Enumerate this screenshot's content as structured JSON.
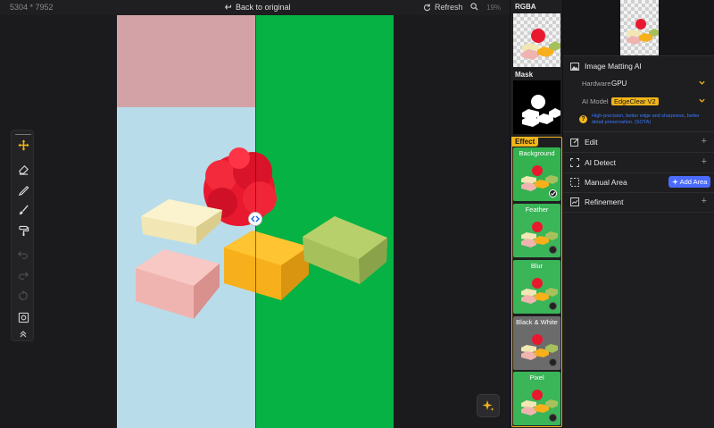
{
  "topbar": {
    "dimensions": "5304 * 7952",
    "back_label": "Back to original",
    "refresh_label": "Refresh",
    "zoom": "19%"
  },
  "thumbs": {
    "rgba_title": "RGBA",
    "mask_title": "Mask",
    "effect_tag": "Effect",
    "effects": [
      {
        "label": "Background",
        "selected": true,
        "bg": "#33b24f"
      },
      {
        "label": "Feather",
        "selected": false,
        "bg": "#3ab558"
      },
      {
        "label": "Blur",
        "selected": false,
        "bg": "#3ab558"
      },
      {
        "label": "Black & White",
        "selected": false,
        "bg": "#6b6b6b"
      },
      {
        "label": "Pixel",
        "selected": false,
        "bg": "#3ab558"
      }
    ]
  },
  "panel": {
    "matting_title": "Image Matting AI",
    "hardware_label": "Hardware",
    "hardware_value": "GPU",
    "model_label": "AI Model",
    "model_value": "EdgeClear  V2",
    "model_note": "High-precision, better edge and sharpness, better detail preservation. (SOTA)",
    "edit_title": "Edit",
    "ai_detect_title": "AI Detect",
    "manual_area_title": "Manual Area",
    "add_area_label": "Add Area",
    "refinement_title": "Refinement"
  },
  "colors": {
    "accent": "#f2b51a",
    "green_screen": "#05b243",
    "add_area_bg": "#4b6bff",
    "link_blue": "#3b79ff"
  },
  "icons": [
    "back-icon",
    "refresh-icon",
    "search-icon",
    "move-icon",
    "eraser-icon",
    "brush-pen-icon",
    "paint-brush-icon",
    "paint-roller-icon",
    "undo-icon",
    "redo-icon",
    "reset-icon",
    "fit-screen-icon",
    "collapse-icon",
    "sparkle-icon",
    "image-icon",
    "edit-icon",
    "ai-detect-icon",
    "manual-area-icon",
    "refinement-icon",
    "compare-handle-icon",
    "help-icon",
    "chevron-down-icon",
    "plus-icon",
    "check-icon"
  ]
}
